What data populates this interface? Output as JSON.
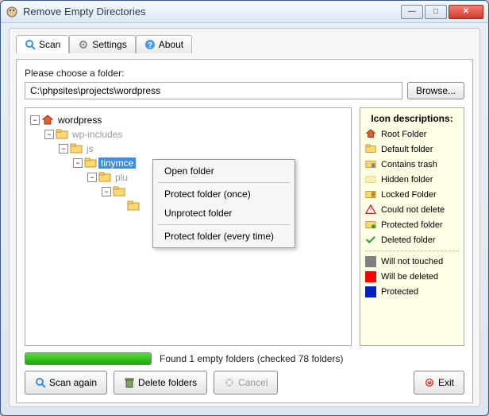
{
  "window": {
    "title": "Remove Empty Directories"
  },
  "tabs": {
    "scan": "Scan",
    "settings": "Settings",
    "about": "About"
  },
  "choose_label": "Please choose a folder:",
  "path_value": "C:\\phpsites\\projects\\wordpress",
  "browse_label": "Browse...",
  "tree": {
    "n0": "wordpress",
    "n1": "wp-includes",
    "n2": "js",
    "n3": "tinymce",
    "n4": "plu",
    "n5": "",
    "n6": ""
  },
  "context_menu": {
    "open": "Open folder",
    "protect_once": "Protect folder (once)",
    "unprotect": "Unprotect folder",
    "protect_always": "Protect folder (every time)"
  },
  "legend": {
    "title": "Icon descriptions:",
    "root": "Root Folder",
    "default": "Default folder",
    "trash": "Contains trash",
    "hidden": "Hidden folder",
    "locked": "Locked Folder",
    "nodelete": "Could not delete",
    "protected": "Protected folder",
    "deleted": "Deleted folder",
    "will_not": "Will not touched",
    "will_del": "Will be deleted",
    "protected2": "Protected",
    "colors": {
      "will_not": "#808080",
      "will_del": "#ff0000",
      "protected": "#0020c0"
    }
  },
  "status": "Found 1 empty folders (checked 78 folders)",
  "buttons": {
    "scan_again": "Scan again",
    "delete": "Delete folders",
    "cancel": "Cancel",
    "exit": "Exit"
  }
}
